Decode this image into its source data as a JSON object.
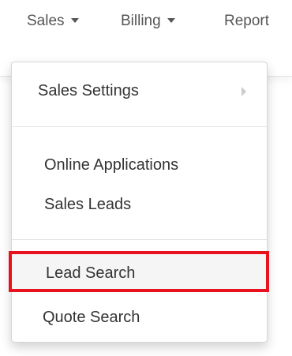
{
  "navbar": {
    "items": [
      {
        "label": "Sales"
      },
      {
        "label": "Billing"
      },
      {
        "label": "Report"
      }
    ]
  },
  "dropdown": {
    "items": [
      {
        "label": "Sales Settings",
        "has_submenu": true
      },
      {
        "label": "Online Applications"
      },
      {
        "label": "Sales Leads"
      },
      {
        "label": "Lead Search",
        "highlighted": true
      },
      {
        "label": "Quote Search"
      }
    ]
  },
  "colors": {
    "highlight_border": "#e8121f",
    "menu_text": "#333333",
    "nav_text": "#555555"
  }
}
